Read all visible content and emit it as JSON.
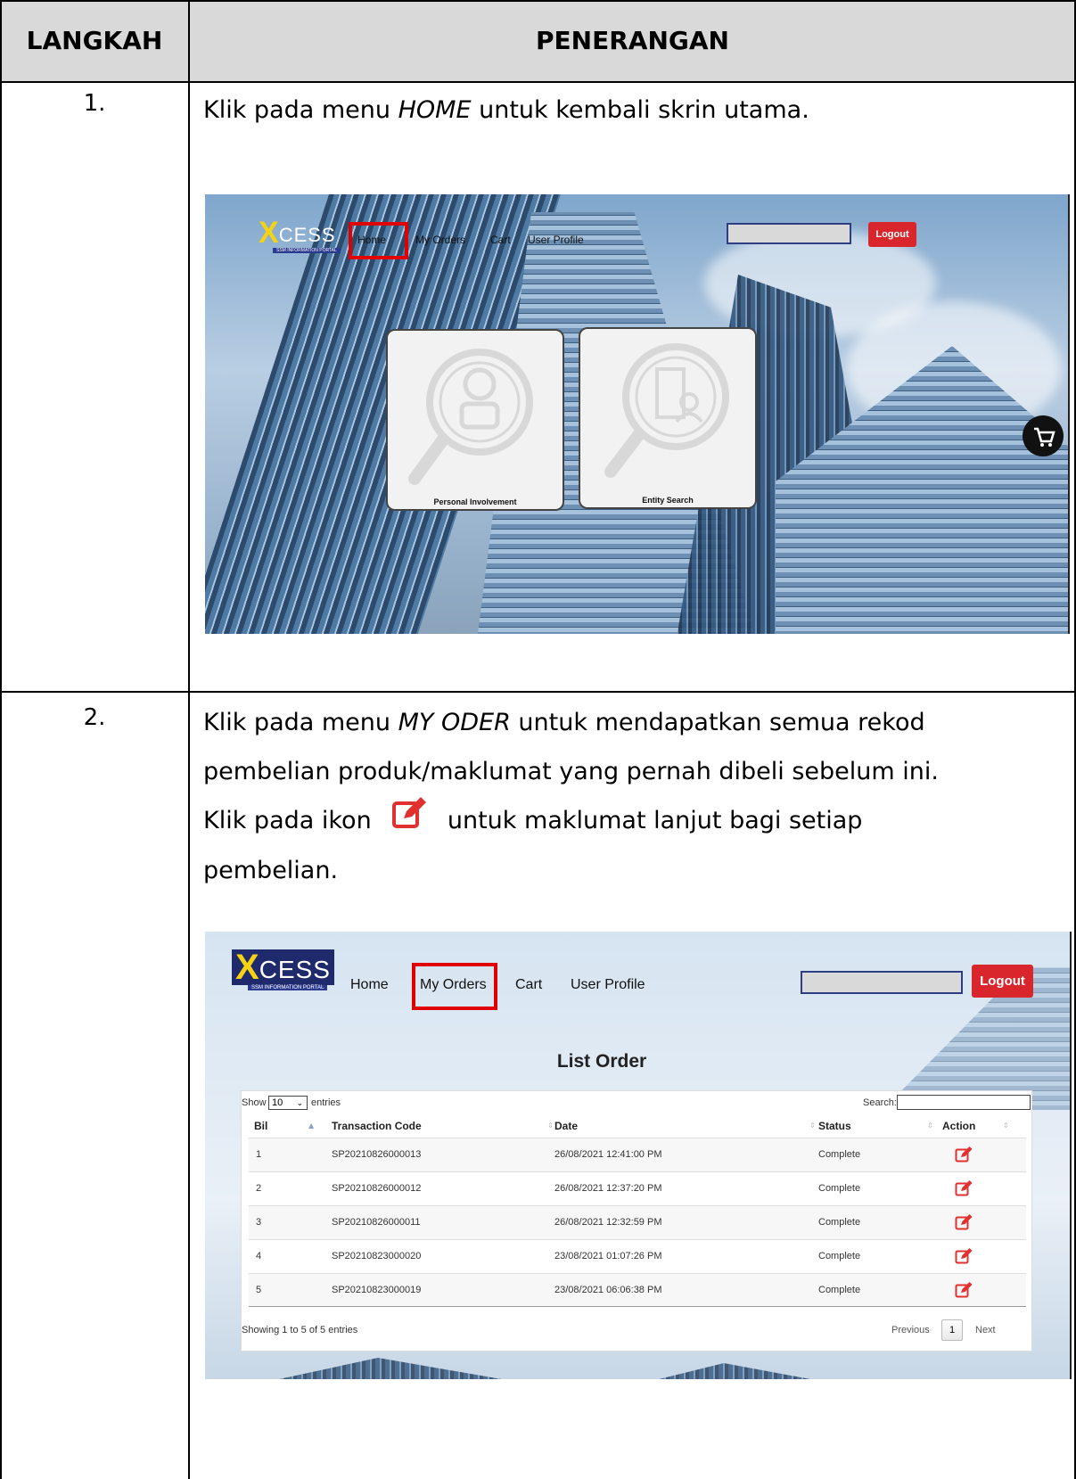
{
  "table": {
    "header": {
      "col1": "LANGKAH",
      "col2": "PENERANGAN"
    },
    "steps": [
      {
        "number": "1.",
        "text_before": "Klik pada menu ",
        "text_em": "HOME",
        "text_after": " untuk kembali skrin utama."
      },
      {
        "number": "2.",
        "line1_before": "Klik pada menu ",
        "line1_em": "MY ODER",
        "line1_after": " untuk mendapatkan semua rekod",
        "line2": "pembelian produk/maklumat yang pernah dibeli sebelum ini.",
        "line3_before": "Klik pada ikon",
        "line3_after": "untuk maklumat lanjut bagi setiap",
        "line4": "pembelian."
      }
    ]
  },
  "screenshot1": {
    "logo_main": "CESS",
    "logo_x": "X",
    "logo_sub": "SSM INFORMATION PORTAL",
    "nav": [
      "Home",
      "My Orders",
      "Cart",
      "User Profile"
    ],
    "logout": "Logout",
    "tiles": [
      "Personal Involvement",
      "Entity Search"
    ],
    "highlight": "Home"
  },
  "screenshot2": {
    "logo_main": "CESS",
    "logo_x": "X",
    "logo_sub": "SSM INFORMATION PORTAL",
    "nav": [
      "Home",
      "My Orders",
      "Cart",
      "User Profile"
    ],
    "logout": "Logout",
    "highlight": "My Orders",
    "title": "List Order",
    "show_label": "Show",
    "entries_value": "10",
    "entries_label": "entries",
    "search_label": "Search:",
    "columns": [
      "Bil",
      "Transaction Code",
      "Date",
      "Status",
      "Action"
    ],
    "rows": [
      {
        "bil": "1",
        "code": "SP20210826000013",
        "date": "26/08/2021 12:41:00 PM",
        "status": "Complete"
      },
      {
        "bil": "2",
        "code": "SP20210826000012",
        "date": "26/08/2021 12:37:20 PM",
        "status": "Complete"
      },
      {
        "bil": "3",
        "code": "SP20210826000011",
        "date": "26/08/2021 12:32:59 PM",
        "status": "Complete"
      },
      {
        "bil": "4",
        "code": "SP20210823000020",
        "date": "23/08/2021 01:07:26 PM",
        "status": "Complete"
      },
      {
        "bil": "5",
        "code": "SP20210823000019",
        "date": "23/08/2021 06:06:38 PM",
        "status": "Complete"
      }
    ],
    "footer_info": "Showing 1 to 5 of 5 entries",
    "prev": "Previous",
    "page": "1",
    "next": "Next"
  },
  "colors": {
    "header_bg": "#d9d9d9",
    "highlight_red": "#e00000",
    "logout_red": "#d9262c",
    "edit_icon_red": "#e03030",
    "logo_yellow": "#f6d215",
    "logo_blue": "#2b3a8f"
  },
  "icons": [
    "edit-icon",
    "cart-icon",
    "person-search-icon",
    "building-search-icon",
    "sort-icon"
  ]
}
